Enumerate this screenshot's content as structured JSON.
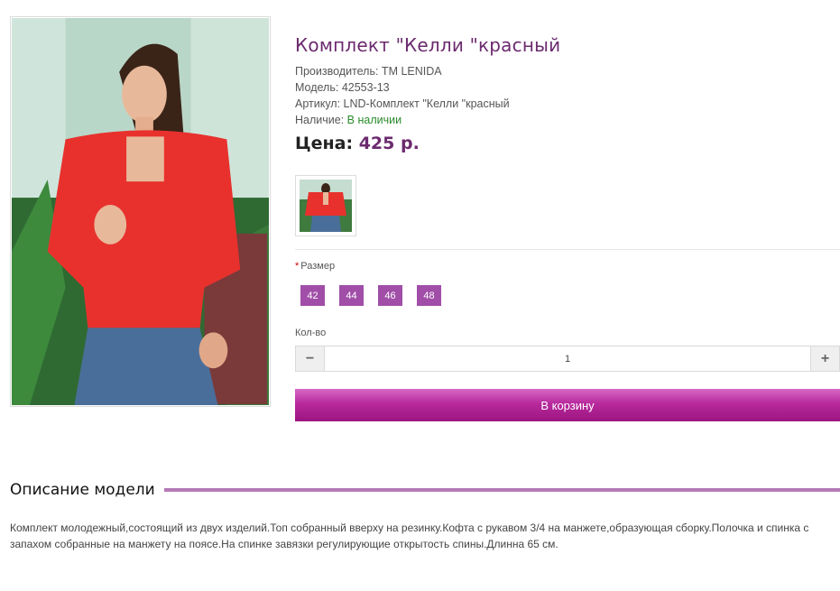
{
  "product": {
    "title": "Комплект \"Келли \"красный",
    "manufacturer": "Производитель: TM LENIDA",
    "model": "Модель: 42553-13",
    "sku": "Артикул: LND-Комплект \"Келли \"красный",
    "availability_label": "Наличие:",
    "availability_value": "В наличии",
    "price_label": "Цена:",
    "price_value": "425 р."
  },
  "options": {
    "size_required_mark": "*",
    "size_label": "Размер",
    "sizes": [
      "42",
      "44",
      "46",
      "48"
    ],
    "qty_label": "Кол-во",
    "qty_value": "1",
    "qty_minus": "−",
    "qty_plus": "+"
  },
  "cart": {
    "button_label": "В корзину"
  },
  "description": {
    "heading": "Описание модели",
    "text": "Комплект молодежный,состоящий из двух изделий.Топ собранный вверху на резинку.Кофта с рукавом 3/4 на манжете,образующая сборку.Полочка и спинка с запахом собранные на манжету на поясе.На спинке завязки регулирующие открытость спины.Длинна 65 см."
  },
  "colors": {
    "accent": "#a04ea8",
    "title": "#6b2a6e",
    "in_stock": "#2a8a2a"
  }
}
